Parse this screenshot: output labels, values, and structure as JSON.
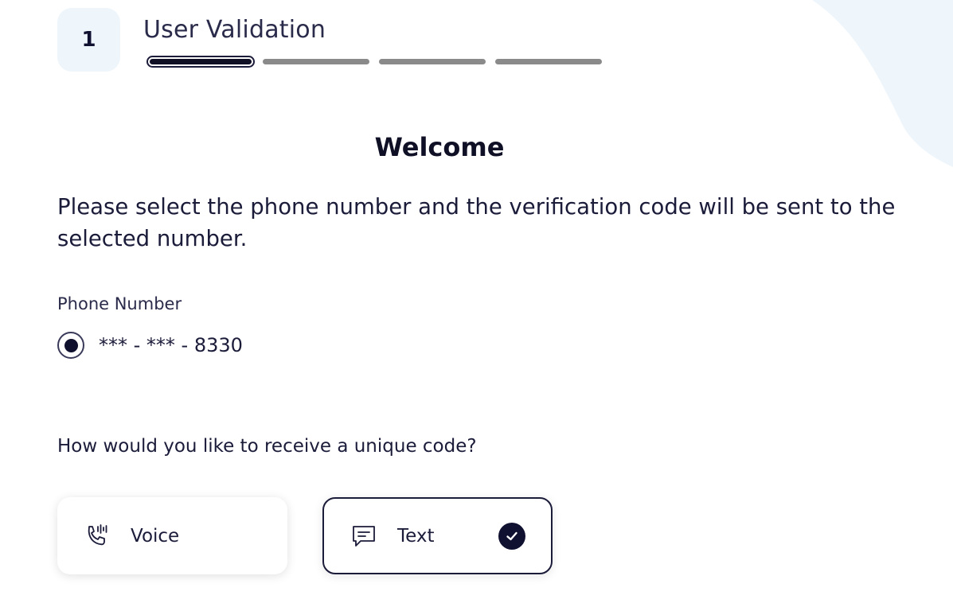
{
  "step": {
    "number": "1",
    "title": "User Validation",
    "total_segments": 4,
    "active_segment": 1
  },
  "welcome": "Welcome",
  "instructions": "Please select the phone number and the verification code will be sent to the selected number.",
  "phone": {
    "label": "Phone Number",
    "options": [
      {
        "value": "*** - *** - 8330",
        "selected": true
      }
    ]
  },
  "method": {
    "question": "How would you like to receive a unique code?",
    "options": [
      {
        "label": "Voice",
        "icon": "phone-voice-icon",
        "selected": false
      },
      {
        "label": "Text",
        "icon": "message-icon",
        "selected": true
      }
    ]
  },
  "colors": {
    "accent": "#101030",
    "background_blob": "#eef6fc",
    "progress_inactive": "#8a8a8a"
  }
}
